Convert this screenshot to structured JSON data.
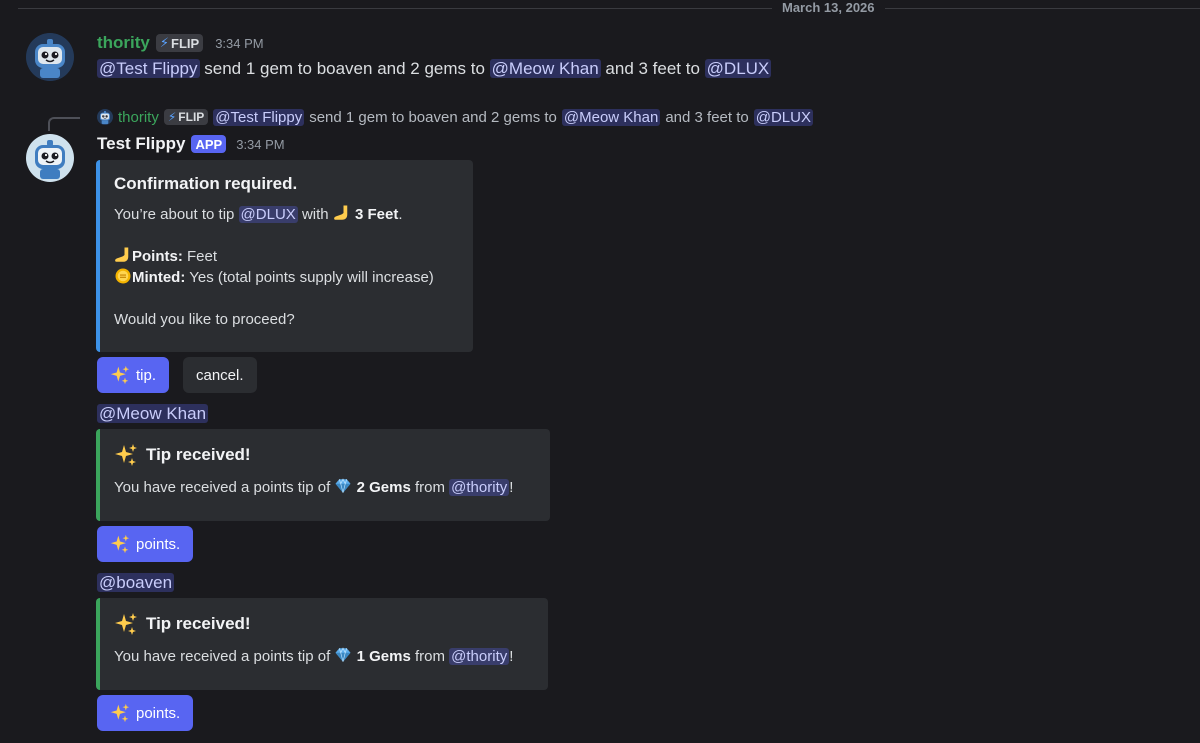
{
  "date_divider": "March 13, 2026",
  "msg1": {
    "author": "thority",
    "author_color": "#3ba55c",
    "badge": "FLIP",
    "timestamp": "3:34 PM",
    "parts": {
      "mention1": "@Test Flippy",
      "text1": " send 1 gem to boaven and 2 gems to ",
      "mention2": "@Meow Khan",
      "text2": " and 3 feet to ",
      "mention3": "@DLUX"
    }
  },
  "reply": {
    "author": "thority",
    "badge": "FLIP",
    "mention1": "@Test Flippy",
    "text1": "send 1 gem to boaven and 2 gems to",
    "mention2": "@Meow Khan",
    "text2": "and 3 feet to",
    "mention3": "@DLUX"
  },
  "msg2": {
    "author": "Test Flippy",
    "badge": "APP",
    "timestamp": "3:34 PM",
    "embed": {
      "title": "Confirmation required.",
      "line1_pre": "You’re about to tip ",
      "line1_mention": "@DLUX",
      "line1_mid": " with ",
      "line1_bold": "3 Feet",
      "line1_end": ".",
      "points_label": "Points:",
      "points_value": " Feet",
      "minted_label": "Minted:",
      "minted_value": " Yes (total points supply will increase)",
      "question": "Would you like to proceed?"
    },
    "buttons": {
      "tip": "tip.",
      "cancel": "cancel."
    }
  },
  "tip1": {
    "mention": "@Meow Khan",
    "title": "Tip received!",
    "pre": "You have received a points tip of ",
    "bold": "2 Gems",
    "from": " from ",
    "from_mention": "@thority",
    "end": "!",
    "button": "points."
  },
  "tip2": {
    "mention": "@boaven",
    "title": "Tip received!",
    "pre": "You have received a points tip of ",
    "bold": "1 Gems",
    "from": " from ",
    "from_mention": "@thority",
    "end": "!",
    "button": "points."
  },
  "colors": {
    "background": "#1a1a1e",
    "blurple": "#5865f2",
    "embed_blue": "#3d92e8",
    "embed_green": "#3ba55c"
  },
  "icons": [
    "bolt-icon",
    "foot-emoji-icon",
    "coin-emoji-icon",
    "gem-emoji-icon",
    "sparkles-emoji-icon"
  ]
}
